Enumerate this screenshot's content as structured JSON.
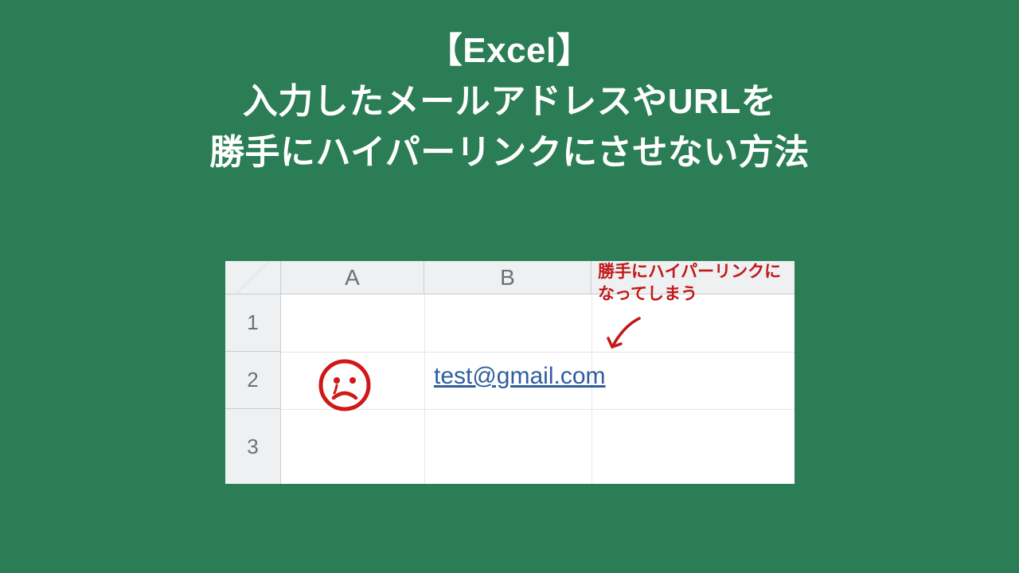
{
  "title": {
    "line1": "【Excel】",
    "line2": "入力したメールアドレスやURLを",
    "line3": "勝手にハイパーリンクにさせない方法"
  },
  "sheet": {
    "columns": {
      "A": "A",
      "B": "B"
    },
    "rows": {
      "r1": "1",
      "r2": "2",
      "r3": "3"
    },
    "cells": {
      "B2": "test@gmail.com"
    }
  },
  "annotation": {
    "line1": "勝手にハイパーリンクに",
    "line2": "なってしまう"
  },
  "icon": {
    "face": "sad-face-icon",
    "arrow": "curved-arrow-icon"
  },
  "colors": {
    "background": "#2a7d54",
    "annotation": "#c21818",
    "link": "#2f5e9e",
    "stamp": "#d11717"
  }
}
